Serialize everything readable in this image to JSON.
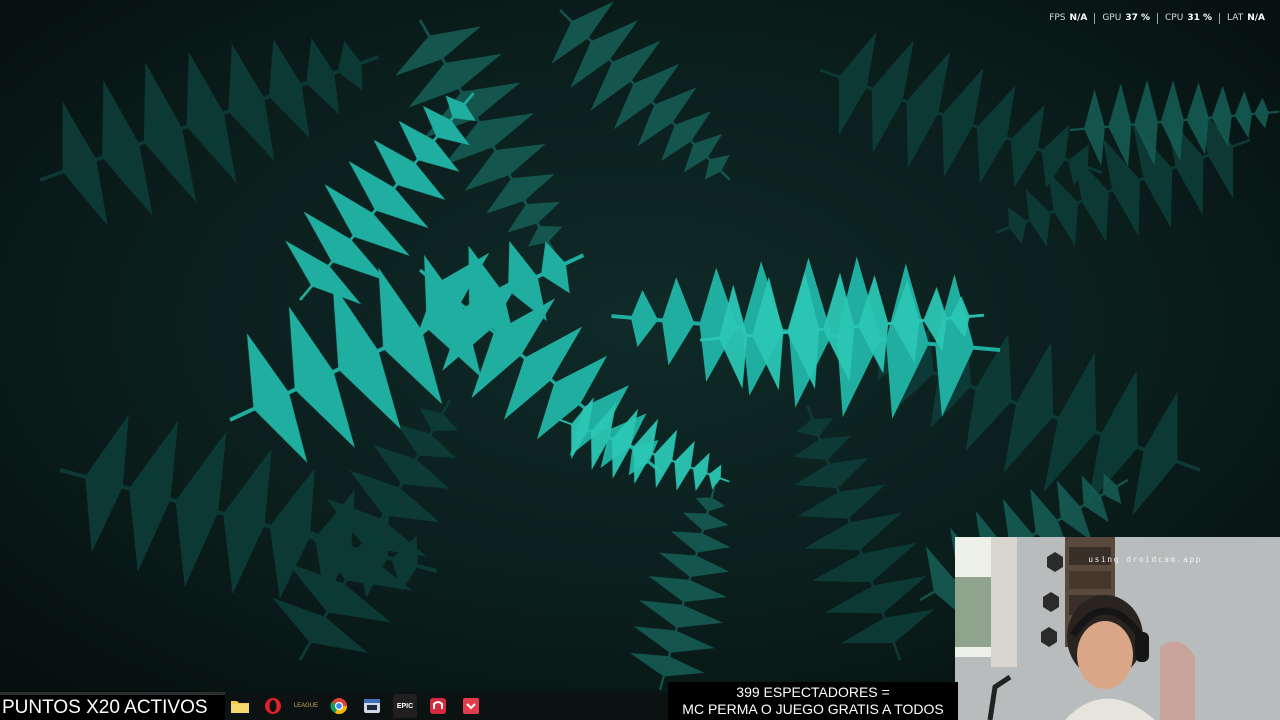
{
  "perf_overlay": {
    "items": [
      {
        "label": "FPS",
        "value": "N/A"
      },
      {
        "label": "GPU",
        "value": "37 %"
      },
      {
        "label": "CPU",
        "value": "31 %"
      },
      {
        "label": "LAT",
        "value": "N/A"
      }
    ]
  },
  "stream": {
    "points_banner": "PUNTOS X20 ACTIVOS",
    "viewers_line1": "399 ESPECTADORES =",
    "viewers_line2": "MC PERMA O JUEGO GRATIS A TODOS",
    "webcam_watermark": "using droidcam.app"
  },
  "taskbar": {
    "icons": [
      "file-explorer-icon",
      "opera-browser-icon",
      "league-icon",
      "chrome-icon",
      "app-window-icon",
      "epic-games-icon",
      "red-app-icon",
      "red-check-app-icon"
    ],
    "league_icon_text": "LEAGUE",
    "epic_icon_text": "EPIC"
  },
  "colors": {
    "wallpaper_bg": "#071613",
    "fern_accent": "#1fb8a8",
    "taskbar_bg": "#0c1211"
  }
}
